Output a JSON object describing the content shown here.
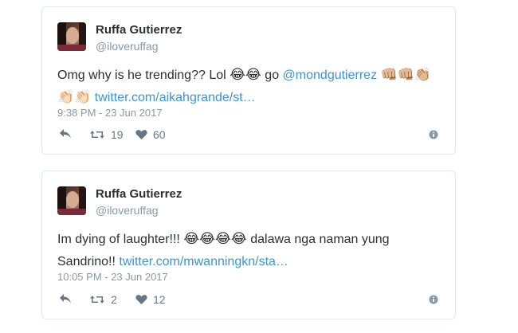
{
  "tweets": [
    {
      "name": "Ruffa Gutierrez",
      "handle": "@iloveruffag",
      "text_before": "Omg why is he trending?? Lol ",
      "emoji_a": "😂😂",
      "text_mid": " go ",
      "mention": "@mondgutierrez",
      "emoji_b": "👊🏼👊🏼👏🏼",
      "emoji_c": "👏🏻👏🏻",
      "link": "twitter.com/aikahgrande/st…",
      "time": "9:38 PM - 23 Jun 2017",
      "retweets": "19",
      "likes": "60"
    },
    {
      "name": "Ruffa Gutierrez",
      "handle": "@iloveruffag",
      "text_before": "Im dying of laughter!!! ",
      "emoji_a": "😂😂😂😂",
      "text_mid": " dalawa nga naman yung Sandrino!! ",
      "link": "twitter.com/mwanningkn/sta…",
      "time": "10:05 PM - 23 Jun 2017",
      "retweets": "2",
      "likes": "12"
    }
  ],
  "icons": {
    "reply": "reply-icon",
    "retweet": "retweet-icon",
    "like": "heart-icon",
    "more": "info-icon"
  },
  "colors": {
    "link": "#3b94d9",
    "muted": "#8899a6",
    "text": "#292f33"
  }
}
